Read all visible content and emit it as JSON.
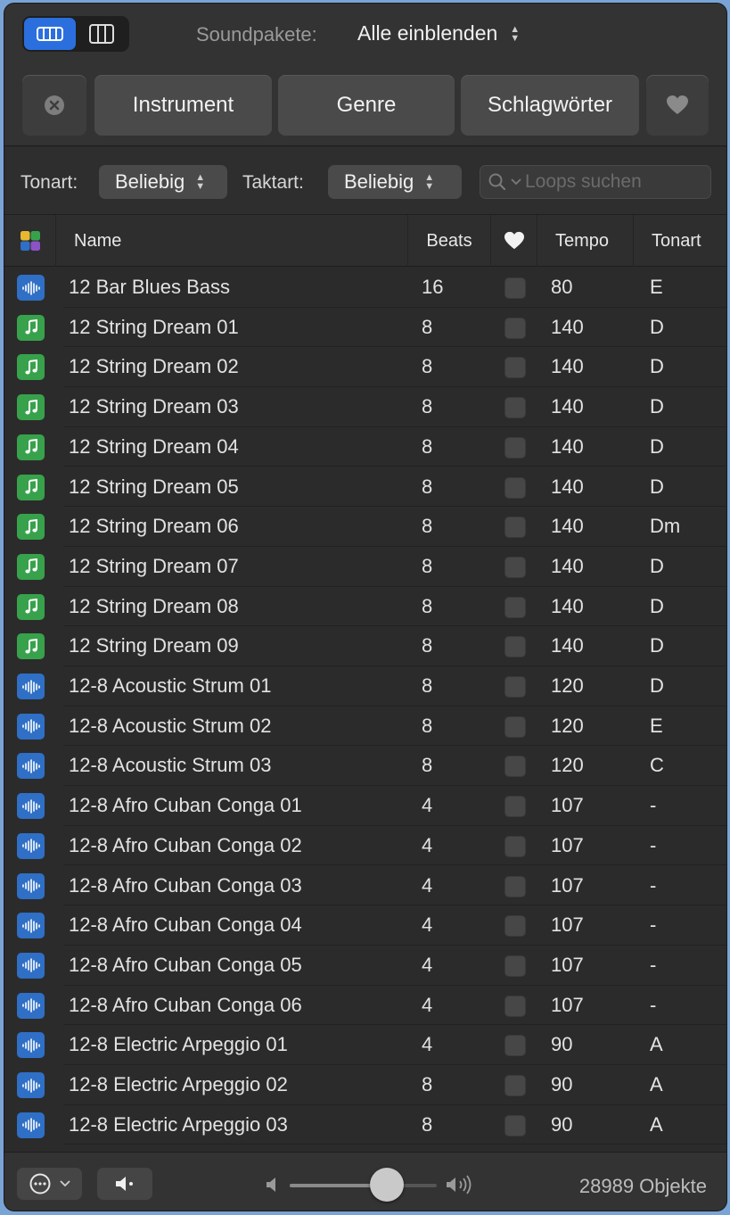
{
  "window": {
    "view_modes": [
      "list-view",
      "column-view"
    ],
    "active_view": "list-view"
  },
  "soundpacks": {
    "label": "Soundpakete:",
    "value": "Alle einblenden"
  },
  "filters": {
    "instrument": "Instrument",
    "genre": "Genre",
    "tags": "Schlagwörter"
  },
  "options": {
    "key_label": "Tonart:",
    "key_value": "Beliebig",
    "time_label": "Taktart:",
    "time_value": "Beliebig",
    "search_placeholder": "Loops suchen"
  },
  "table": {
    "columns": {
      "name": "Name",
      "beats": "Beats",
      "tempo": "Tempo",
      "key": "Tonart"
    },
    "rows": [
      {
        "type": "audio",
        "name": "12 Bar Blues Bass",
        "beats": "16",
        "tempo": "80",
        "key": "E"
      },
      {
        "type": "midi",
        "name": "12 String Dream 01",
        "beats": "8",
        "tempo": "140",
        "key": "D"
      },
      {
        "type": "midi",
        "name": "12 String Dream 02",
        "beats": "8",
        "tempo": "140",
        "key": "D"
      },
      {
        "type": "midi",
        "name": "12 String Dream 03",
        "beats": "8",
        "tempo": "140",
        "key": "D"
      },
      {
        "type": "midi",
        "name": "12 String Dream 04",
        "beats": "8",
        "tempo": "140",
        "key": "D"
      },
      {
        "type": "midi",
        "name": "12 String Dream 05",
        "beats": "8",
        "tempo": "140",
        "key": "D"
      },
      {
        "type": "midi",
        "name": "12 String Dream 06",
        "beats": "8",
        "tempo": "140",
        "key": "Dm"
      },
      {
        "type": "midi",
        "name": "12 String Dream 07",
        "beats": "8",
        "tempo": "140",
        "key": "D"
      },
      {
        "type": "midi",
        "name": "12 String Dream 08",
        "beats": "8",
        "tempo": "140",
        "key": "D"
      },
      {
        "type": "midi",
        "name": "12 String Dream 09",
        "beats": "8",
        "tempo": "140",
        "key": "D"
      },
      {
        "type": "audio",
        "name": "12-8 Acoustic Strum 01",
        "beats": "8",
        "tempo": "120",
        "key": "D"
      },
      {
        "type": "audio",
        "name": "12-8 Acoustic Strum 02",
        "beats": "8",
        "tempo": "120",
        "key": "E"
      },
      {
        "type": "audio",
        "name": "12-8 Acoustic Strum 03",
        "beats": "8",
        "tempo": "120",
        "key": "C"
      },
      {
        "type": "audio",
        "name": "12-8 Afro Cuban Conga 01",
        "beats": "4",
        "tempo": "107",
        "key": "-"
      },
      {
        "type": "audio",
        "name": "12-8 Afro Cuban Conga 02",
        "beats": "4",
        "tempo": "107",
        "key": "-"
      },
      {
        "type": "audio",
        "name": "12-8 Afro Cuban Conga 03",
        "beats": "4",
        "tempo": "107",
        "key": "-"
      },
      {
        "type": "audio",
        "name": "12-8 Afro Cuban Conga 04",
        "beats": "4",
        "tempo": "107",
        "key": "-"
      },
      {
        "type": "audio",
        "name": "12-8 Afro Cuban Conga 05",
        "beats": "4",
        "tempo": "107",
        "key": "-"
      },
      {
        "type": "audio",
        "name": "12-8 Afro Cuban Conga 06",
        "beats": "4",
        "tempo": "107",
        "key": "-"
      },
      {
        "type": "audio",
        "name": "12-8 Electric Arpeggio 01",
        "beats": "4",
        "tempo": "90",
        "key": "A"
      },
      {
        "type": "audio",
        "name": "12-8 Electric Arpeggio 02",
        "beats": "8",
        "tempo": "90",
        "key": "A"
      },
      {
        "type": "audio",
        "name": "12-8 Electric Arpeggio 03",
        "beats": "8",
        "tempo": "90",
        "key": "A"
      }
    ]
  },
  "footer": {
    "volume_level": 0.66,
    "count": "28989 Objekte"
  },
  "colors": {
    "accent": "#2b6fde",
    "audio": "#2f6fc6",
    "midi": "#37a24b"
  }
}
